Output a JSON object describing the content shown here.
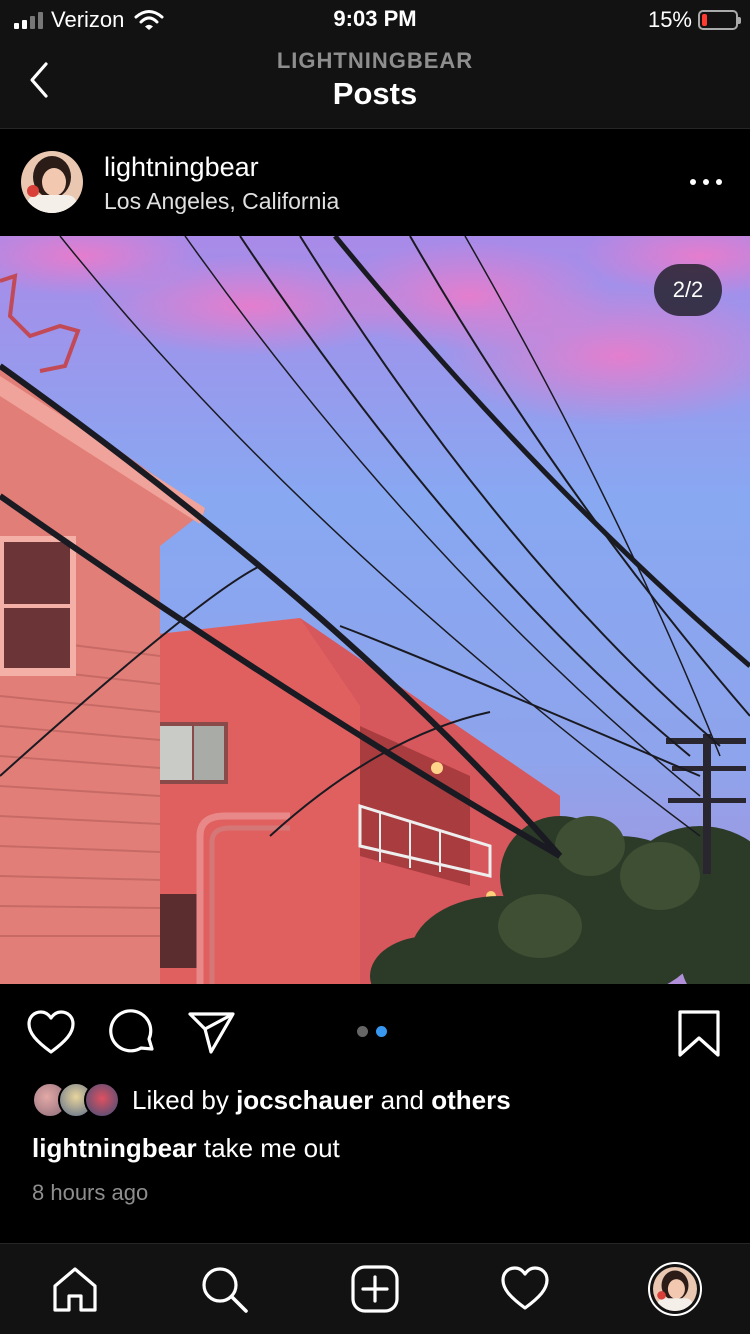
{
  "status_bar": {
    "carrier": "Verizon",
    "time": "9:03 PM",
    "battery_percent": "15%",
    "battery_level": 0.15
  },
  "header": {
    "username": "LIGHTNINGBEAR",
    "title": "Posts",
    "back_icon": "chevron-left-icon"
  },
  "post": {
    "author": "lightningbear",
    "location": "Los Angeles, California",
    "more_icon": "ellipsis-icon",
    "image_counter": "2/2",
    "page_dots": {
      "total": 2,
      "active": 2
    },
    "actions": {
      "like_icon": "heart-icon",
      "comment_icon": "comment-icon",
      "share_icon": "paper-plane-icon",
      "save_icon": "bookmark-icon"
    },
    "likes": {
      "prefix": "Liked by",
      "liker": "jocschauer",
      "joiner": "and",
      "others": "others"
    },
    "caption": {
      "author": "lightningbear",
      "text": "take me out"
    },
    "time_ago": "8 hours ago"
  },
  "tab_bar": {
    "items": [
      "home-icon",
      "search-icon",
      "add-post-icon",
      "activity-heart-icon",
      "profile-avatar"
    ]
  },
  "colors": {
    "background": "#000000",
    "bar_background": "#121212",
    "accent_dot": "#3897f0",
    "muted_text": "#8e8e8e",
    "battery_low": "#ff3b30"
  }
}
